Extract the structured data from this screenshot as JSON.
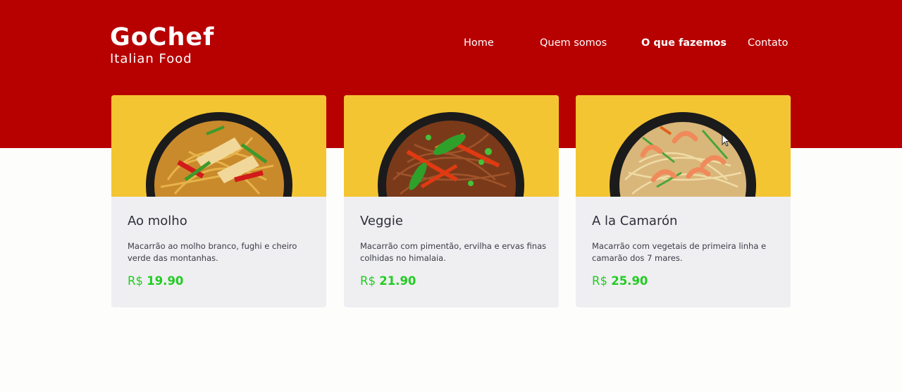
{
  "brand": {
    "title": "GoChef",
    "subtitle": "Italian Food"
  },
  "nav": {
    "items": [
      {
        "label": "Home",
        "active": false
      },
      {
        "label": "Quem somos",
        "active": false
      },
      {
        "label": "O que fazemos",
        "active": true
      },
      {
        "label": "Contato",
        "active": false
      }
    ]
  },
  "products": [
    {
      "title": "Ao molho",
      "description": "Macarrão ao molho branco, fughi e cheiro verde das montanhas.",
      "currency": "R$",
      "price": "19.90",
      "image": "noodle-bowl-chicken-icon"
    },
    {
      "title": "Veggie",
      "description": "Macarrão com pimentão, ervilha e ervas finas colhidas no himalaia.",
      "currency": "R$",
      "price": "21.90",
      "image": "noodle-bowl-veggie-icon"
    },
    {
      "title": "A la Camarón",
      "description": "Macarrão com vegetais de primeira linha e camarão dos 7 mares.",
      "currency": "R$",
      "price": "25.90",
      "image": "noodle-bowl-shrimp-icon"
    }
  ],
  "colors": {
    "hero_bg": "#b70000",
    "card_image_bg": "#f4c532",
    "card_bg": "#efeff2",
    "price": "#22cc22",
    "page_bg": "#fdfdfb"
  }
}
